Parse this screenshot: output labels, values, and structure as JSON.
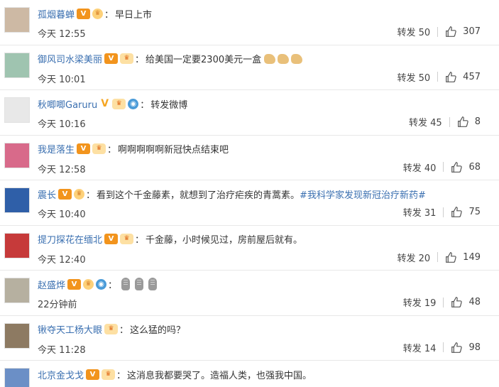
{
  "comments": [
    {
      "username": "孤烟暮蝉",
      "badges": [
        "v",
        "member"
      ],
      "colon": "：",
      "text": "早日上市",
      "time": "今天 12:55",
      "repost": "转发 50",
      "likes": "307",
      "avatar_color": "#cdb9a4"
    },
    {
      "username": "御风司水梁美丽",
      "badges": [
        "v",
        "member2"
      ],
      "colon": "：",
      "text": "给美国一定要2300美元一盒",
      "emoji": [
        "muscle",
        "muscle",
        "muscle"
      ],
      "time": "今天 10:01",
      "repost": "转发 50",
      "likes": "457",
      "avatar_color": "#9fc4b0"
    },
    {
      "username": "秋唧唧Garuru",
      "badges": [
        "v-yellow",
        "member2",
        "globe"
      ],
      "colon": "：",
      "text": "转发微博",
      "time": "今天 10:16",
      "repost": "转发 45",
      "likes": "8",
      "avatar_color": "#e8e8e8"
    },
    {
      "username": "我是落生",
      "badges": [
        "v",
        "member2"
      ],
      "colon": "：",
      "text": "啊啊啊啊啊新冠快点结束吧",
      "time": "今天 12:58",
      "repost": "转发 40",
      "likes": "68",
      "avatar_color": "#d86a8a"
    },
    {
      "username": "震长",
      "badges": [
        "v",
        "member"
      ],
      "colon": "：",
      "text": "看到这个千金藤素，就想到了治疗疟疾的青蒿素。",
      "hashtag": "#我科学家发现新冠治疗新药#",
      "time": "今天 10:40",
      "repost": "转发 31",
      "likes": "75",
      "avatar_color": "#2f5fa8"
    },
    {
      "username": "提刀探花在缅北",
      "badges": [
        "v",
        "member2"
      ],
      "colon": "：",
      "text": "千金藤，小时候见过，房前屋后就有。",
      "time": "今天 12:40",
      "repost": "转发 20",
      "likes": "149",
      "avatar_color": "#c63a3a"
    },
    {
      "username": "赵盛烨",
      "badges": [
        "v",
        "member",
        "globe"
      ],
      "colon": "：",
      "text": "",
      "voice_icons": 3,
      "time": "22分钟前",
      "repost": "转发 19",
      "likes": "48",
      "avatar_color": "#b6b0a0"
    },
    {
      "username": "锹夺天工杨大眼",
      "badges": [
        "member2"
      ],
      "colon": "：",
      "text": "这么猛的吗？",
      "time": "今天 11:28",
      "repost": "转发 14",
      "likes": "98",
      "avatar_color": "#8d7a62"
    },
    {
      "username": "北京金戈戈",
      "badges": [
        "v",
        "member2"
      ],
      "colon": "：",
      "text": "这消息我都要哭了。造福人类，也强我中国。",
      "time": "",
      "repost": "",
      "likes": "",
      "avatar_color": "#6b8fc6"
    }
  ],
  "colors": {
    "username": "#3a6fb0",
    "hashtag": "#3a6fb0",
    "badge_v": "#f2941d",
    "divider": "#e8e8e8"
  },
  "icons": {
    "like": "thumbs-up-icon",
    "verified": "v-badge-icon",
    "member": "member-badge-icon",
    "globe": "globe-icon",
    "voice": "microphone-icon"
  }
}
